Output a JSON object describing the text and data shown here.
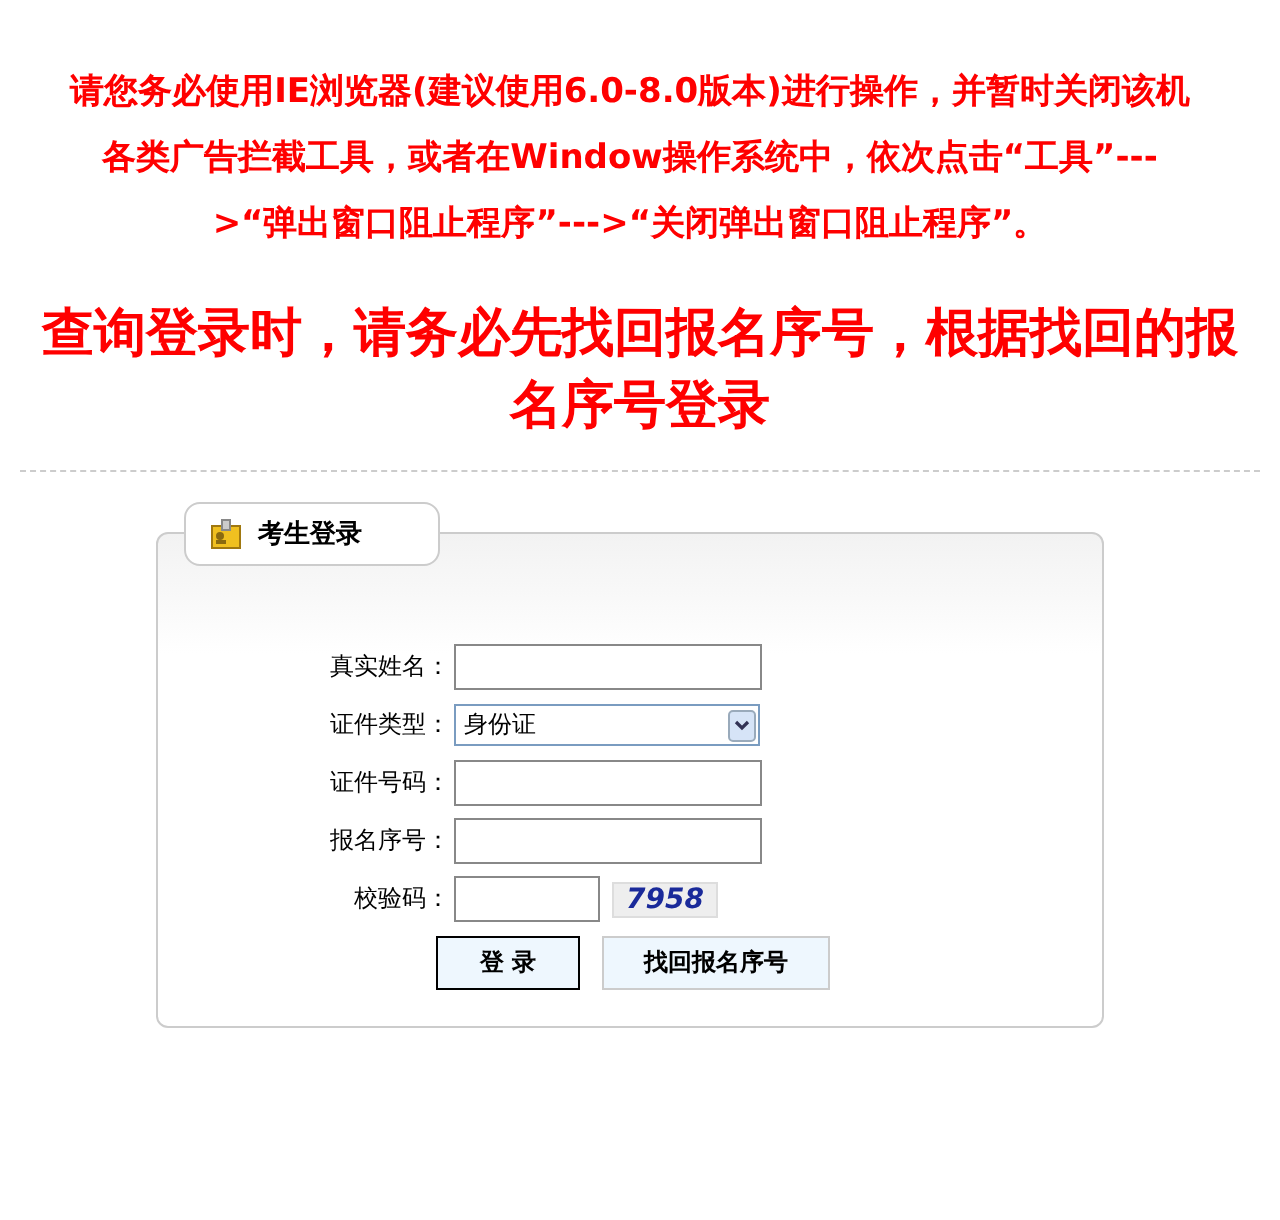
{
  "notice": "请您务必使用IE浏览器(建议使用6.0-8.0版本)进行操作，并暂时关闭该机各类广告拦截工具，或者在Window操作系统中，依次点击“工具”--->“弹出窗口阻止程序”--->“关闭弹出窗口阻止程序”。",
  "headline": "查询登录时，请务必先找回报名序号，根据找回的报名序号登录",
  "login_panel": {
    "title": "考生登录",
    "fields": [
      {
        "kind": "text",
        "label": "真实姓名："
      },
      {
        "kind": "select",
        "label": "证件类型：",
        "value": "身份证"
      },
      {
        "kind": "text",
        "label": "证件号码："
      },
      {
        "kind": "text",
        "label": "报名序号："
      },
      {
        "kind": "captcha",
        "label": "校验码：",
        "captcha": "7958"
      }
    ],
    "buttons": [
      {
        "label": "登 录",
        "kind": "primary"
      },
      {
        "label": "找回报名序号",
        "kind": "secondary"
      }
    ]
  }
}
